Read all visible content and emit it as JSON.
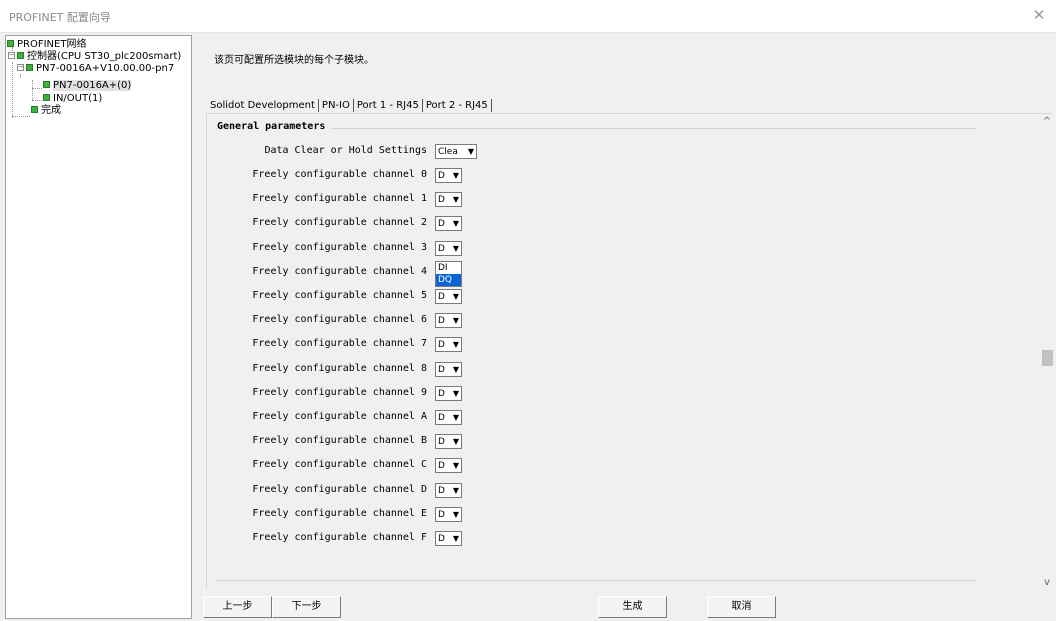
{
  "window": {
    "title": "PROFINET 配置向导",
    "close_glyph": "✕"
  },
  "tree": {
    "root": "PROFINET网络",
    "controller": "控制器(CPU ST30_plc200smart)",
    "device": "PN7-0016A+V10.00.00-pn7",
    "module": "PN7-0016A+(0)",
    "submodule": "IN/OUT(1)",
    "finish": "完成"
  },
  "main": {
    "description": "该页可配置所选模块的每个子模块。",
    "tabs": [
      "Solidot Development",
      "PN-IO",
      "Port 1 - RJ45",
      "Port 2 - RJ45"
    ],
    "group_title": "General parameters",
    "data_clear": {
      "label": "Data Clear or Hold Settings",
      "value": "Clea"
    },
    "channels": [
      {
        "label": "Freely configurable channel 0",
        "value": "D"
      },
      {
        "label": "Freely configurable channel 1",
        "value": "D"
      },
      {
        "label": "Freely configurable channel 2",
        "value": "D"
      },
      {
        "label": "Freely configurable channel 3",
        "value": "D"
      },
      {
        "label": "Freely configurable channel 4",
        "value": "D"
      },
      {
        "label": "Freely configurable channel 5",
        "value": "D"
      },
      {
        "label": "Freely configurable channel 6",
        "value": "D"
      },
      {
        "label": "Freely configurable channel 7",
        "value": "D"
      },
      {
        "label": "Freely configurable channel 8",
        "value": "D"
      },
      {
        "label": "Freely configurable channel 9",
        "value": "D"
      },
      {
        "label": "Freely configurable channel A",
        "value": "D"
      },
      {
        "label": "Freely configurable channel B",
        "value": "D"
      },
      {
        "label": "Freely configurable channel C",
        "value": "D"
      },
      {
        "label": "Freely configurable channel D",
        "value": "D"
      },
      {
        "label": "Freely configurable channel E",
        "value": "D"
      },
      {
        "label": "Freely configurable channel F",
        "value": "D"
      }
    ],
    "dropdown_options": [
      "DI",
      "DQ"
    ],
    "dropdown_highlighted": "DQ"
  },
  "scrollbar": {
    "up_glyph": "^",
    "down_glyph": "v"
  },
  "buttons": {
    "prev": "上一步",
    "next": "下一步",
    "generate": "生成",
    "cancel": "取消"
  },
  "colors": {
    "tree_icon": "#3cb043",
    "highlight": "#0a64d6"
  }
}
